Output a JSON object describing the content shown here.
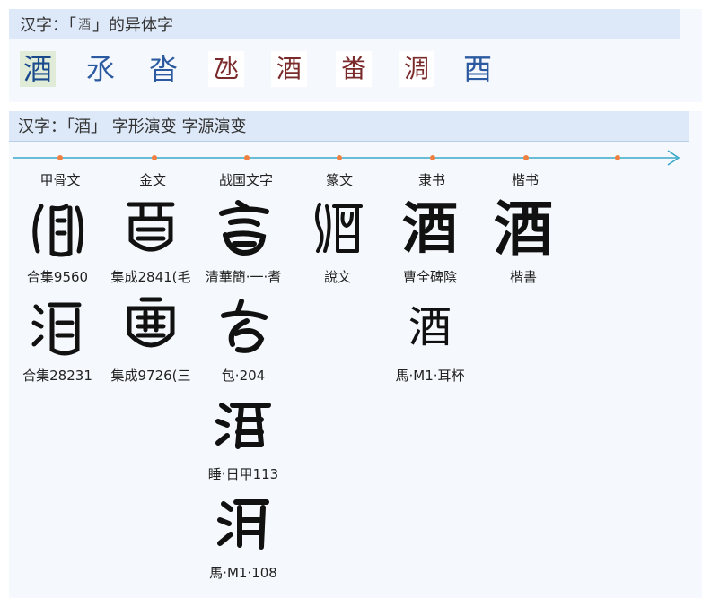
{
  "variants_section": {
    "title_prefix": "汉字：「",
    "title_char": "酒",
    "title_suffix": "」的异体字",
    "variants": [
      "酒",
      "氶",
      "沓",
      "氹",
      "酒",
      "畨",
      "淍",
      "酉"
    ]
  },
  "evolution_section": {
    "title": "汉字：「酒」 字形演变 字源演变",
    "eras": [
      "甲骨文",
      "金文",
      "战国文字",
      "篆文",
      "隶书",
      "楷书"
    ],
    "columns": [
      {
        "era_index": 0,
        "items": [
          {
            "source": "合集9560"
          },
          {
            "source": "合集28231"
          }
        ]
      },
      {
        "era_index": 1,
        "items": [
          {
            "source": "集成2841(毛"
          },
          {
            "source": "集成9726(三"
          }
        ]
      },
      {
        "era_index": 2,
        "items": [
          {
            "source": "清華簡·一·耆"
          },
          {
            "source": "包·204"
          },
          {
            "source": "睡·日甲113"
          },
          {
            "source": "馬·M1·108"
          }
        ]
      },
      {
        "era_index": 3,
        "items": [
          {
            "source": "說文"
          }
        ]
      },
      {
        "era_index": 4,
        "items": [
          {
            "source": "曹全碑陰",
            "glyph": "酒"
          },
          {
            "source": "馬·M1·耳杯",
            "glyph": "酒"
          }
        ]
      },
      {
        "era_index": 5,
        "items": [
          {
            "source": "楷書",
            "glyph": "酒"
          }
        ]
      }
    ]
  },
  "colors": {
    "timeline_line": "#3aa8c8",
    "timeline_dot": "#f08040",
    "header_bg": "#dde9f8"
  }
}
